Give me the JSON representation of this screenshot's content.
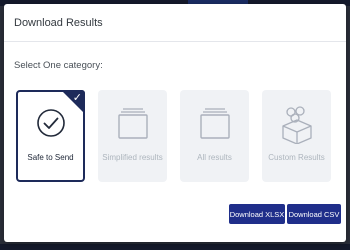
{
  "dialog": {
    "title": "Download Results",
    "prompt": "Select One category:"
  },
  "categories": [
    {
      "label": "Safe to Send",
      "icon": "check-circle-icon",
      "selected": true
    },
    {
      "label": "Simplified results",
      "icon": "stack-icon",
      "selected": false
    },
    {
      "label": "All results",
      "icon": "stack-icon",
      "selected": false
    },
    {
      "label": "Custom Results",
      "icon": "cubes-icon",
      "selected": false
    }
  ],
  "buttons": {
    "xlsx": "Download XLSX",
    "csv": "Download CSV"
  },
  "colors": {
    "accent": "#1d2a5a",
    "button": "#1f2e8a",
    "card_bg": "#f0f2f5",
    "muted_text": "#adb5bd"
  }
}
